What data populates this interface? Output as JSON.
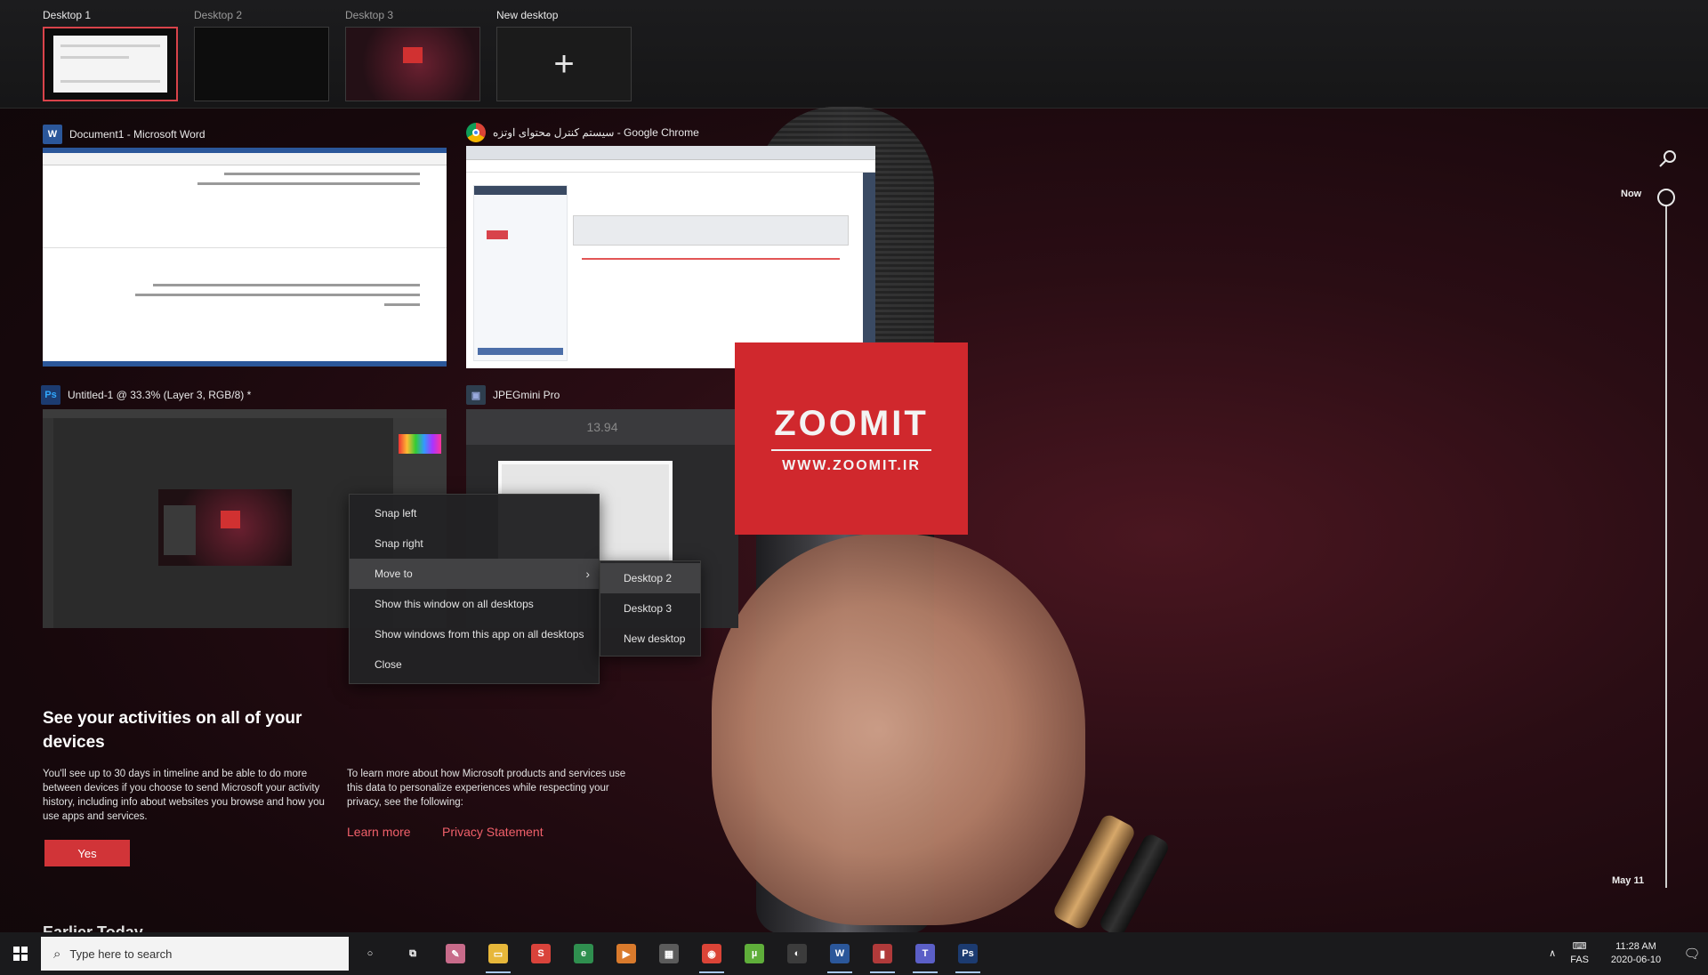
{
  "desktops": [
    {
      "label": "Desktop 1",
      "active": true
    },
    {
      "label": "Desktop 2",
      "active": false
    },
    {
      "label": "Desktop 3",
      "active": false
    }
  ],
  "new_desktop": {
    "label": "New desktop",
    "glyph": "+"
  },
  "windows": {
    "word": {
      "icon": "word-icon",
      "icon_letter": "W",
      "title": "Document1 - Microsoft Word",
      "color": "#2b579a"
    },
    "chrome": {
      "icon": "chrome-icon",
      "title": "سیستم کنترل محتوای اوتزه - Google Chrome"
    },
    "photoshop": {
      "icon": "photoshop-icon",
      "icon_letter": "Ps",
      "title": "Untitled-1 @ 33.3% (Layer 3, RGB/8) *",
      "color": "#1c3b70"
    },
    "jpegmini": {
      "icon": "jpegmini-icon",
      "title": "JPEGmini Pro",
      "percent": "13.94"
    }
  },
  "wallpaper": {
    "brand": "ZOOMIT",
    "url": "WWW.ZOOMIT.IR",
    "flag_color": "#d0282d"
  },
  "context_menu": {
    "items": [
      "Snap left",
      "Snap right",
      "Move to",
      "Show this window on all desktops",
      "Show windows from this app on all desktops",
      "Close"
    ],
    "hovered": "Move to",
    "submenu": [
      "Desktop 2",
      "Desktop 3",
      "New desktop"
    ],
    "submenu_hovered": "Desktop 2"
  },
  "promo": {
    "title": "See your activities on all of your devices",
    "text": "You'll see up to 30 days in timeline and be able to do more between devices if you choose to send Microsoft your activity history, including info about websites you browse and how you use apps and services.",
    "yes_label": "Yes",
    "privacy_text": "To learn more about how Microsoft products and services use this data to personalize experiences while respecting your privacy, see the following:",
    "learn_more": "Learn more",
    "privacy_statement": "Privacy Statement",
    "section": "Earlier Today"
  },
  "timeline": {
    "now_label": "Now",
    "date_label": "May 11"
  },
  "taskbar": {
    "search_placeholder": "Type here to search",
    "apps": [
      {
        "name": "cortana-icon",
        "glyph": "○",
        "color": "transparent",
        "running": false
      },
      {
        "name": "task-view-icon",
        "glyph": "⧉",
        "color": "transparent",
        "running": false
      },
      {
        "name": "paint-icon",
        "glyph": "✎",
        "color": "#c86b8a",
        "running": false
      },
      {
        "name": "file-explorer-icon",
        "glyph": "▭",
        "color": "#e7b73a",
        "running": true
      },
      {
        "name": "smartgit-icon",
        "glyph": "S",
        "color": "#d9433b",
        "running": false
      },
      {
        "name": "edge-icon",
        "glyph": "e",
        "color": "#2f8f4f",
        "running": false
      },
      {
        "name": "media-icon",
        "glyph": "▶",
        "color": "#d97a2c",
        "running": false
      },
      {
        "name": "calculator-icon",
        "glyph": "▦",
        "color": "#5b5b5b",
        "running": false
      },
      {
        "name": "chrome-icon",
        "glyph": "◉",
        "color": "#db4437",
        "running": true
      },
      {
        "name": "utorrent-icon",
        "glyph": "µ",
        "color": "#5fae3a",
        "running": false
      },
      {
        "name": "photo-viewer-icon",
        "glyph": "◐",
        "color": "#3c3c3c",
        "running": false
      },
      {
        "name": "word-icon",
        "glyph": "W",
        "color": "#2b579a",
        "running": true
      },
      {
        "name": "recorder-icon",
        "glyph": "▮",
        "color": "#b03a3a",
        "running": true
      },
      {
        "name": "teams-icon",
        "glyph": "T",
        "color": "#5b5fc7",
        "running": true
      },
      {
        "name": "photoshop-icon",
        "glyph": "Ps",
        "color": "#1c3b70",
        "running": true
      }
    ],
    "tray": {
      "language": "FAS",
      "time": "11:28 AM",
      "date": "2020-06-10"
    }
  }
}
